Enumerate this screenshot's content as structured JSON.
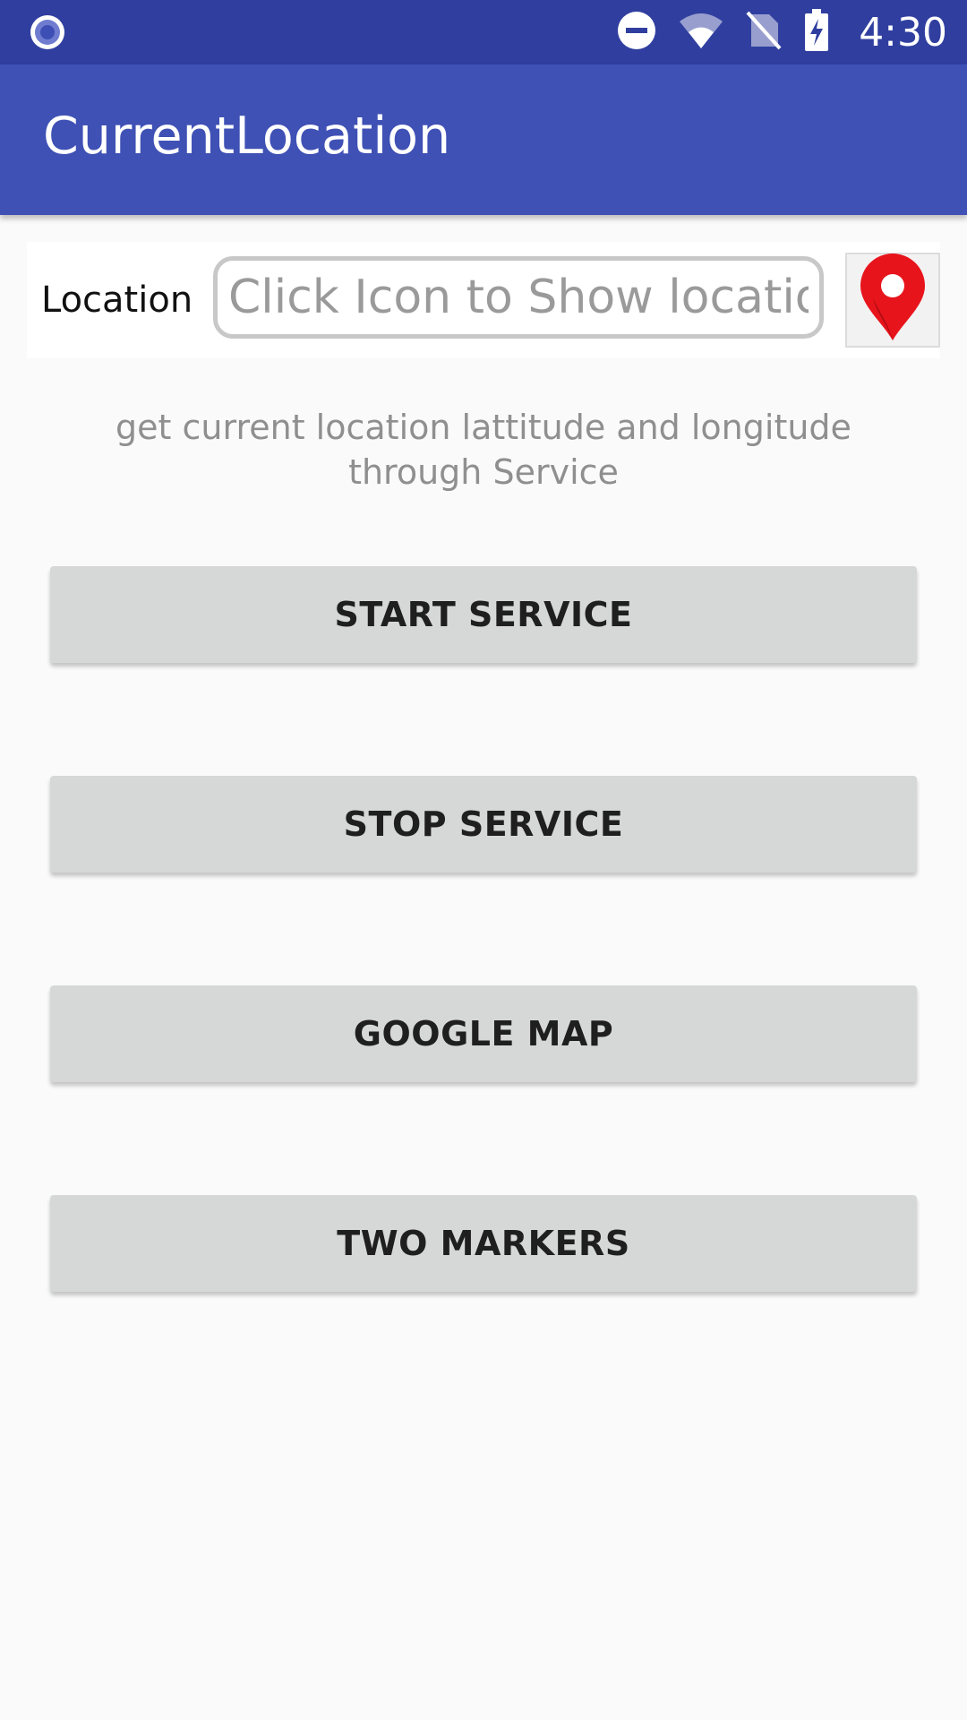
{
  "status_bar": {
    "time": "4:30",
    "icons": [
      "notification-circle-icon",
      "do-not-disturb-icon",
      "wifi-icon",
      "no-sim-icon",
      "battery-charging-icon"
    ]
  },
  "app_bar": {
    "title": "CurrentLocation"
  },
  "location_row": {
    "label": "Location",
    "input_value": "",
    "input_placeholder": "Click Icon to Show location",
    "button_icon": "location-pin-icon"
  },
  "description": "get current location lattitude and longitude through Service",
  "buttons": [
    {
      "label": "START SERVICE"
    },
    {
      "label": "STOP SERVICE"
    },
    {
      "label": "GOOGLE MAP"
    },
    {
      "label": "TWO MARKERS"
    }
  ],
  "colors": {
    "status_bar": "#303f9f",
    "app_bar": "#3f51b5",
    "background": "#fafafa",
    "button": "#d6d7d7",
    "pin": "#e8141c"
  }
}
